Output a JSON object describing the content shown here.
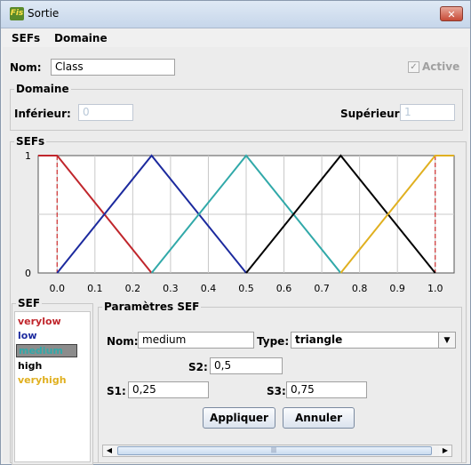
{
  "window": {
    "title": "Sortie",
    "app_icon_text": "Fis"
  },
  "menu": [
    {
      "label": "SEFs"
    },
    {
      "label": "Domaine"
    }
  ],
  "form": {
    "name_label": "Nom:",
    "name_value": "Class",
    "active_label": "Active",
    "active_checked": true
  },
  "domain": {
    "title": "Domaine",
    "lower_label": "Inférieur:",
    "lower_value": "0",
    "upper_label": "Supérieur:",
    "upper_value": "1"
  },
  "sefs_group": {
    "title": "SEFs"
  },
  "chart_data": {
    "type": "line",
    "xlim": [
      -0.05,
      1.05
    ],
    "ylim": [
      0,
      1
    ],
    "x_ticks": [
      "0.0",
      "0.1",
      "0.2",
      "0.3",
      "0.4",
      "0.5",
      "0.6",
      "0.7",
      "0.8",
      "0.9",
      "1.0"
    ],
    "y_ticks": [
      "1",
      "0"
    ],
    "domain_markers": [
      0,
      1
    ],
    "grid": true,
    "series": [
      {
        "name": "verylow",
        "color": "#c0262c",
        "points": [
          [
            -0.05,
            1
          ],
          [
            0,
            1
          ],
          [
            0.25,
            0
          ]
        ]
      },
      {
        "name": "low",
        "color": "#1c2a9e",
        "points": [
          [
            0,
            0
          ],
          [
            0.25,
            1
          ],
          [
            0.5,
            0
          ]
        ]
      },
      {
        "name": "medium",
        "color": "#31a9a9",
        "points": [
          [
            0.25,
            0
          ],
          [
            0.5,
            1
          ],
          [
            0.75,
            0
          ]
        ]
      },
      {
        "name": "high",
        "color": "#000000",
        "points": [
          [
            0.5,
            0
          ],
          [
            0.75,
            1
          ],
          [
            1,
            0
          ]
        ]
      },
      {
        "name": "veryhigh",
        "color": "#e0b020",
        "points": [
          [
            0.75,
            0
          ],
          [
            1,
            1
          ],
          [
            1.05,
            1
          ]
        ]
      }
    ]
  },
  "sef_list": {
    "title": "SEF",
    "items": [
      {
        "label": "verylow",
        "color": "#c0262c"
      },
      {
        "label": "low",
        "color": "#1c2a9e"
      },
      {
        "label": "medium",
        "color": "#31a9a9",
        "selected": true
      },
      {
        "label": "high",
        "color": "#000000"
      },
      {
        "label": "veryhigh",
        "color": "#e0b020"
      }
    ]
  },
  "params": {
    "title": "Paramètres SEF",
    "name_label": "Nom:",
    "name_value": "medium",
    "type_label": "Type:",
    "type_value": "triangle",
    "s1_label": "S1:",
    "s1_value": "0,25",
    "s2_label": "S2:",
    "s2_value": "0,5",
    "s3_label": "S3:",
    "s3_value": "0,75",
    "apply_label": "Appliquer",
    "cancel_label": "Annuler"
  },
  "scrollbar": {
    "left_arrow": "◀",
    "right_arrow": "▶",
    "grip": "|||"
  },
  "icons": {
    "close": "✕",
    "check": "✓",
    "dropdown": "▼"
  }
}
